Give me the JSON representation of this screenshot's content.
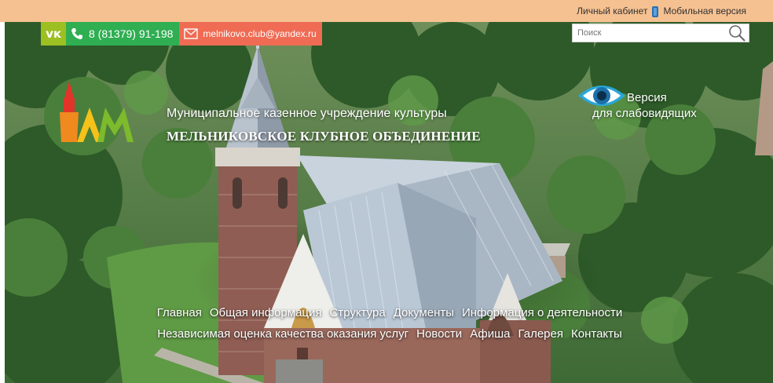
{
  "topbar": {
    "cabinet_label": "Личный кабинет",
    "mobile_label": "Мобильная версия"
  },
  "contacts": {
    "vk_label": "VK",
    "phone": "8 (81379) 91-198",
    "email": "melnikovo.club@yandex.ru"
  },
  "search": {
    "placeholder": "Поиск",
    "value": ""
  },
  "org": {
    "subtitle": "Муниципальное казенное учреждение культуры",
    "name": "МЕЛЬНИКОВСКОЕ КЛУБНОЕ ОБЪЕДИНЕНИЕ"
  },
  "accessibility": {
    "line1": "Версия",
    "line2": "для слабовидящих"
  },
  "nav": {
    "row1": [
      "Главная",
      "Общая информация",
      "Структура",
      "Документы",
      "Информация о деятельности"
    ],
    "row2": [
      "Независимая оценка качества оказания услуг",
      "Новости",
      "Афиша",
      "Галерея",
      "Контакты"
    ]
  },
  "colors": {
    "topbar": "#f6c191",
    "vk": "#9cbf22",
    "phone": "#2fae52",
    "mail": "#ef6b53",
    "eye": "#29a7d9"
  },
  "icons": {
    "vk": "vk-icon",
    "phone": "phone-icon",
    "mail": "envelope-icon",
    "search": "magnifier-icon",
    "mobile": "smartphone-icon",
    "accessibility": "eye-icon",
    "logo": "mko-logo"
  }
}
